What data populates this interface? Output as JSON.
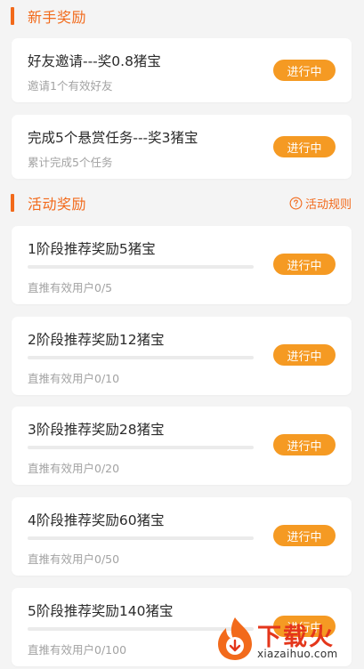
{
  "newbie_section": {
    "title": "新手奖励",
    "items": [
      {
        "title": "好友邀请---奖0.8猪宝",
        "subtitle": "邀请1个有效好友",
        "status": "进行中"
      },
      {
        "title": "完成5个悬赏任务---奖3猪宝",
        "subtitle": "累计完成5个任务",
        "status": "进行中"
      }
    ]
  },
  "activity_section": {
    "title": "活动奖励",
    "rules_label": "活动规则",
    "items": [
      {
        "title": "1阶段推荐奖励5猪宝",
        "progress": 0,
        "subtitle": "直推有效用户0/5",
        "status": "进行中"
      },
      {
        "title": "2阶段推荐奖励12猪宝",
        "progress": 0,
        "subtitle": "直推有效用户0/10",
        "status": "进行中"
      },
      {
        "title": "3阶段推荐奖励28猪宝",
        "progress": 0,
        "subtitle": "直推有效用户0/20",
        "status": "进行中"
      },
      {
        "title": "4阶段推荐奖励60猪宝",
        "progress": 0,
        "subtitle": "直推有效用户0/50",
        "status": "进行中"
      },
      {
        "title": "5阶段推荐奖励140猪宝",
        "progress": 0,
        "subtitle": "直推有效用户0/100",
        "status": "进行中"
      }
    ]
  },
  "watermark": {
    "brand": "下载火",
    "url": "xiazaihuo.com"
  },
  "colors": {
    "accent": "#f26a1b",
    "button": "#f59a23",
    "background": "#f4f4f4"
  },
  "icons": {
    "rules": "question-circle-icon",
    "watermark": "flame-logo-icon"
  }
}
